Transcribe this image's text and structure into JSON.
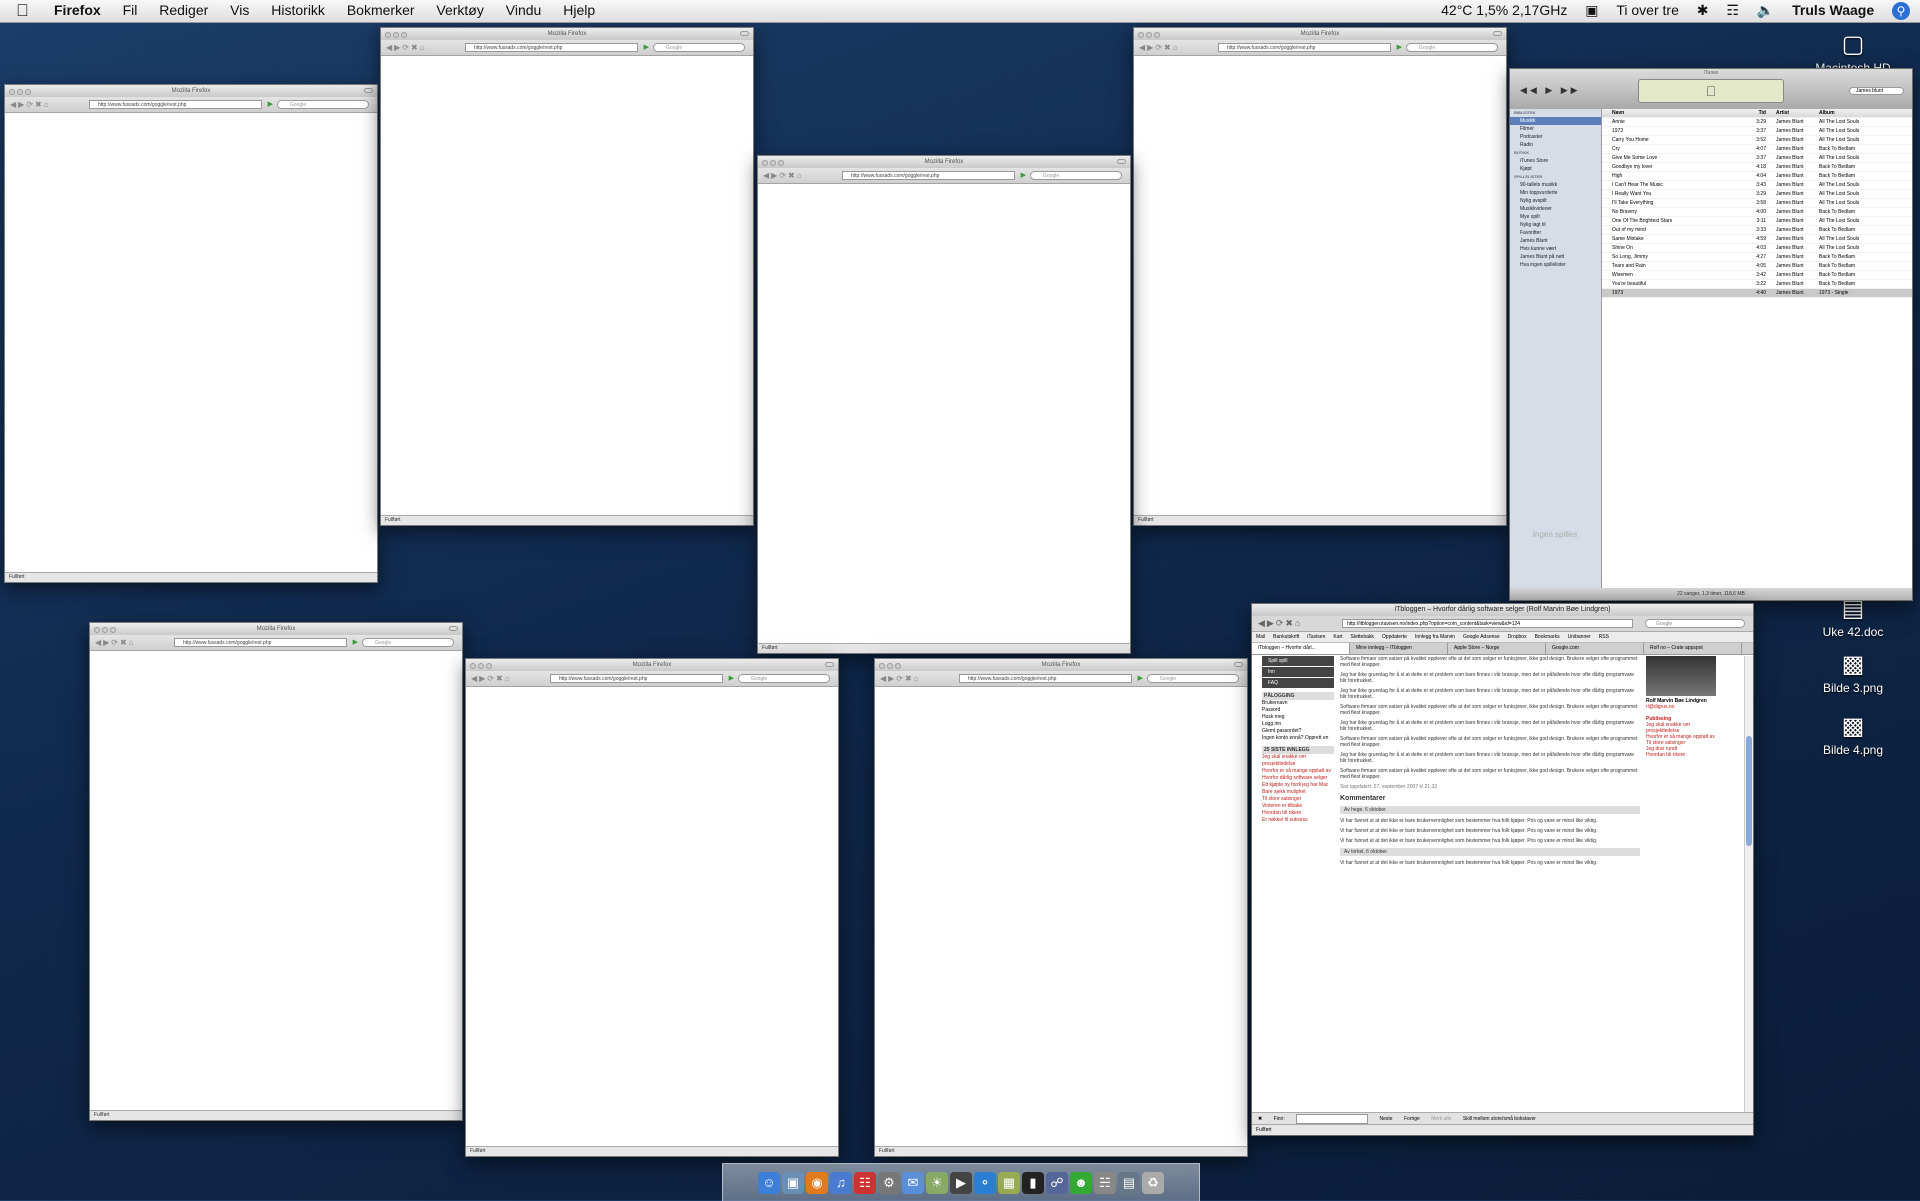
{
  "menubar": {
    "app_name": "Firefox",
    "menus": [
      "Fil",
      "Rediger",
      "Vis",
      "Historikk",
      "Bokmerker",
      "Verktøy",
      "Vindu",
      "Hjelp"
    ],
    "cpu_status": "42°C 1,5% 2,17GHz",
    "clock": "Ti over tre",
    "user": "Truls Waage"
  },
  "firefox": {
    "window_title": "Mozilla Firefox",
    "url": "http://www.fussads.com/goggle/rest.php",
    "search_placeholder": "Google",
    "status": "Fullført"
  },
  "itunes": {
    "title": "iTunes",
    "search_value": "James blunt",
    "sources": [
      "BIBLIOTEK",
      "Musikk",
      "Filmer",
      "Podcaster",
      "Radio",
      "BUTIKK",
      "iTunes Store",
      "Kjøpt",
      "SPILLELISTER",
      "90-tallets musikk",
      "Min toppvurderte",
      "Nylig avspilt",
      "Musikkvideoer",
      "Mye spilt",
      "Nylig lagt til",
      "Favoritter",
      "James Blunt",
      "Hvis kunne vært",
      "James Blunt på nett",
      "Hva ingen spillelister"
    ],
    "columns": [
      "Navn",
      "Tid",
      "Artist",
      "Album"
    ],
    "rows": [
      {
        "name": "Annie",
        "time": "3:29",
        "artist": "James Blunt",
        "album": "All The Lost Souls"
      },
      {
        "name": "1973",
        "time": "3:37",
        "artist": "James Blunt",
        "album": "All The Lost Souls"
      },
      {
        "name": "Carry You Home",
        "time": "3:52",
        "artist": "James Blunt",
        "album": "All The Lost Souls"
      },
      {
        "name": "Cry",
        "time": "4:07",
        "artist": "James Blunt",
        "album": "Back To Bedlam"
      },
      {
        "name": "Give Me Some Love",
        "time": "3:37",
        "artist": "James Blunt",
        "album": "All The Lost Souls"
      },
      {
        "name": "Goodbye my lover",
        "time": "4:18",
        "artist": "James Blunt",
        "album": "Back To Bedlam"
      },
      {
        "name": "High",
        "time": "4:04",
        "artist": "James Blunt",
        "album": "Back To Bedlam"
      },
      {
        "name": "I Can't Hear The Music",
        "time": "3:43",
        "artist": "James Blunt",
        "album": "All The Lost Souls"
      },
      {
        "name": "I Really Want You",
        "time": "3:29",
        "artist": "James Blunt",
        "album": "All The Lost Souls"
      },
      {
        "name": "I'll Take Everything",
        "time": "3:58",
        "artist": "James Blunt",
        "album": "All The Lost Souls"
      },
      {
        "name": "No Bravery",
        "time": "4:00",
        "artist": "James Blunt",
        "album": "Back To Bedlam"
      },
      {
        "name": "One Of The Brightest Stars",
        "time": "3:11",
        "artist": "James Blunt",
        "album": "All The Lost Souls"
      },
      {
        "name": "Out of my mind",
        "time": "3:33",
        "artist": "James Blunt",
        "album": "Back To Bedlam"
      },
      {
        "name": "Same Mistake",
        "time": "4:59",
        "artist": "James Blunt",
        "album": "All The Lost Souls"
      },
      {
        "name": "Shine On",
        "time": "4:03",
        "artist": "James Blunt",
        "album": "All The Lost Souls"
      },
      {
        "name": "So Long, Jimmy",
        "time": "4:27",
        "artist": "James Blunt",
        "album": "Back To Bedlam"
      },
      {
        "name": "Tears and Rain",
        "time": "4:05",
        "artist": "James Blunt",
        "album": "Back To Bedlam"
      },
      {
        "name": "Wisemen",
        "time": "3:42",
        "artist": "James Blunt",
        "album": "Back To Bedlam"
      },
      {
        "name": "You're beautiful",
        "time": "3:22",
        "artist": "James Blunt",
        "album": "Back To Bedlam"
      },
      {
        "name": "1973",
        "time": "4:40",
        "artist": "James Blunt",
        "album": "1973 - Single"
      }
    ],
    "status": "22 sanger, 1,3 timer, 118,6 MB",
    "empty_label": "Ingen spilles"
  },
  "desktop": {
    "icons": [
      "Macintosh HD",
      "Uke 42.doc",
      "Bilde 3.png",
      "Bilde 4.png"
    ]
  },
  "blog": {
    "title": "iTbloggen – Hvorfor dårlig software selger (Rolf Marvin Bøe Lindgren)",
    "url": "http://itbloggen.itavisen.no/index.php?option=com_content&task=view&id=124",
    "search_placeholder": "Google",
    "bookmarks": [
      "Mail",
      "Bankutskrift",
      "iTavisen",
      "Kart",
      "Slettebakk",
      "Oppdaterte",
      "Innlegg fra Marvin",
      "Google Adsense",
      "Dropbox",
      "Bookmarks",
      "Unibanner",
      "RSS"
    ],
    "tabs": [
      "iTbloggen – Hvorfor dårl...",
      "Mine innlegg – iTbloggen",
      "Apple Store – Norge",
      "Google.com",
      "Rolf no – Crate appspot"
    ],
    "menu": [
      "Spill spill",
      "Inn",
      "FAQ"
    ],
    "login_header": "PÅLOGGING",
    "login_labels": [
      "Brukernavn",
      "Passord",
      "Husk meg",
      "Logg inn",
      "Glemt passordet?",
      "Ingen konto ennå? Opprett en"
    ],
    "recent_header": "25 SISTE INNLEGG",
    "recent": [
      "Jeg skal snakke om prosjektledelse",
      "Hvorfor er så mange opptatt av",
      "Hvorfor dårlig software selger",
      "Ett kjøpte ny fordi jeg har Mac",
      "Bare sjekk mulighet",
      "Til store satsinger",
      "Vinteren er tilbake",
      "Hvordan bli rikere",
      "Er nøkkel til suksess"
    ],
    "main_heading": "Kommentarer",
    "main_intro": "Software firmaer som satser på kvalitet opplever ofte at det som selger er funksjoner, ikke god design. Brukere velger ofte programmet med flest knapper.",
    "main_para": "Jeg har ikke grunnlag for å si at dette er et problem som bare finnes i vår bransje, men det er påfallende hvor ofte dårlig programvare blir foretrukket.",
    "published": "Sist oppdatert: 27. september 2007 kl 21:32",
    "comment_by": "Av hege, 6 oktober",
    "comment_text": "Vi har funnet ut at det ikke er bare brukervennlighet som bestemmer hva folk kjøper. Pris og vane er minst like viktig.",
    "comment_by_2": "Av torkel, 6 oktober",
    "right_name": "Rolf Marvin Bøe Lindgren",
    "right_email": "rl@digrus.no",
    "right_heading": "Publiseing",
    "right_links": [
      "Jeg skal snakke om prosjektledelse",
      "Hvorfor er så mange opptatt av",
      "Til store satsinger",
      "Jeg drar rundt",
      "Hvordan bli rikere"
    ],
    "find_label": "Finn:",
    "find_next": "Neste",
    "find_prev": "Forrige",
    "find_mark": "Merk alle",
    "find_case": "Skill mellom store/små bokstaver",
    "status": "Fullført"
  },
  "dock": {
    "icons": [
      "finder-icon",
      "preview-icon",
      "firefox-icon",
      "itunes-icon",
      "ical-icon",
      "system-prefs-icon",
      "mail-icon",
      "photo-icon",
      "imovie-icon",
      "safari-icon",
      "gallery-icon",
      "terminal-icon",
      "network-icon",
      "chat-icon",
      "airport-icon",
      "documents-icon",
      "trash-icon"
    ]
  }
}
